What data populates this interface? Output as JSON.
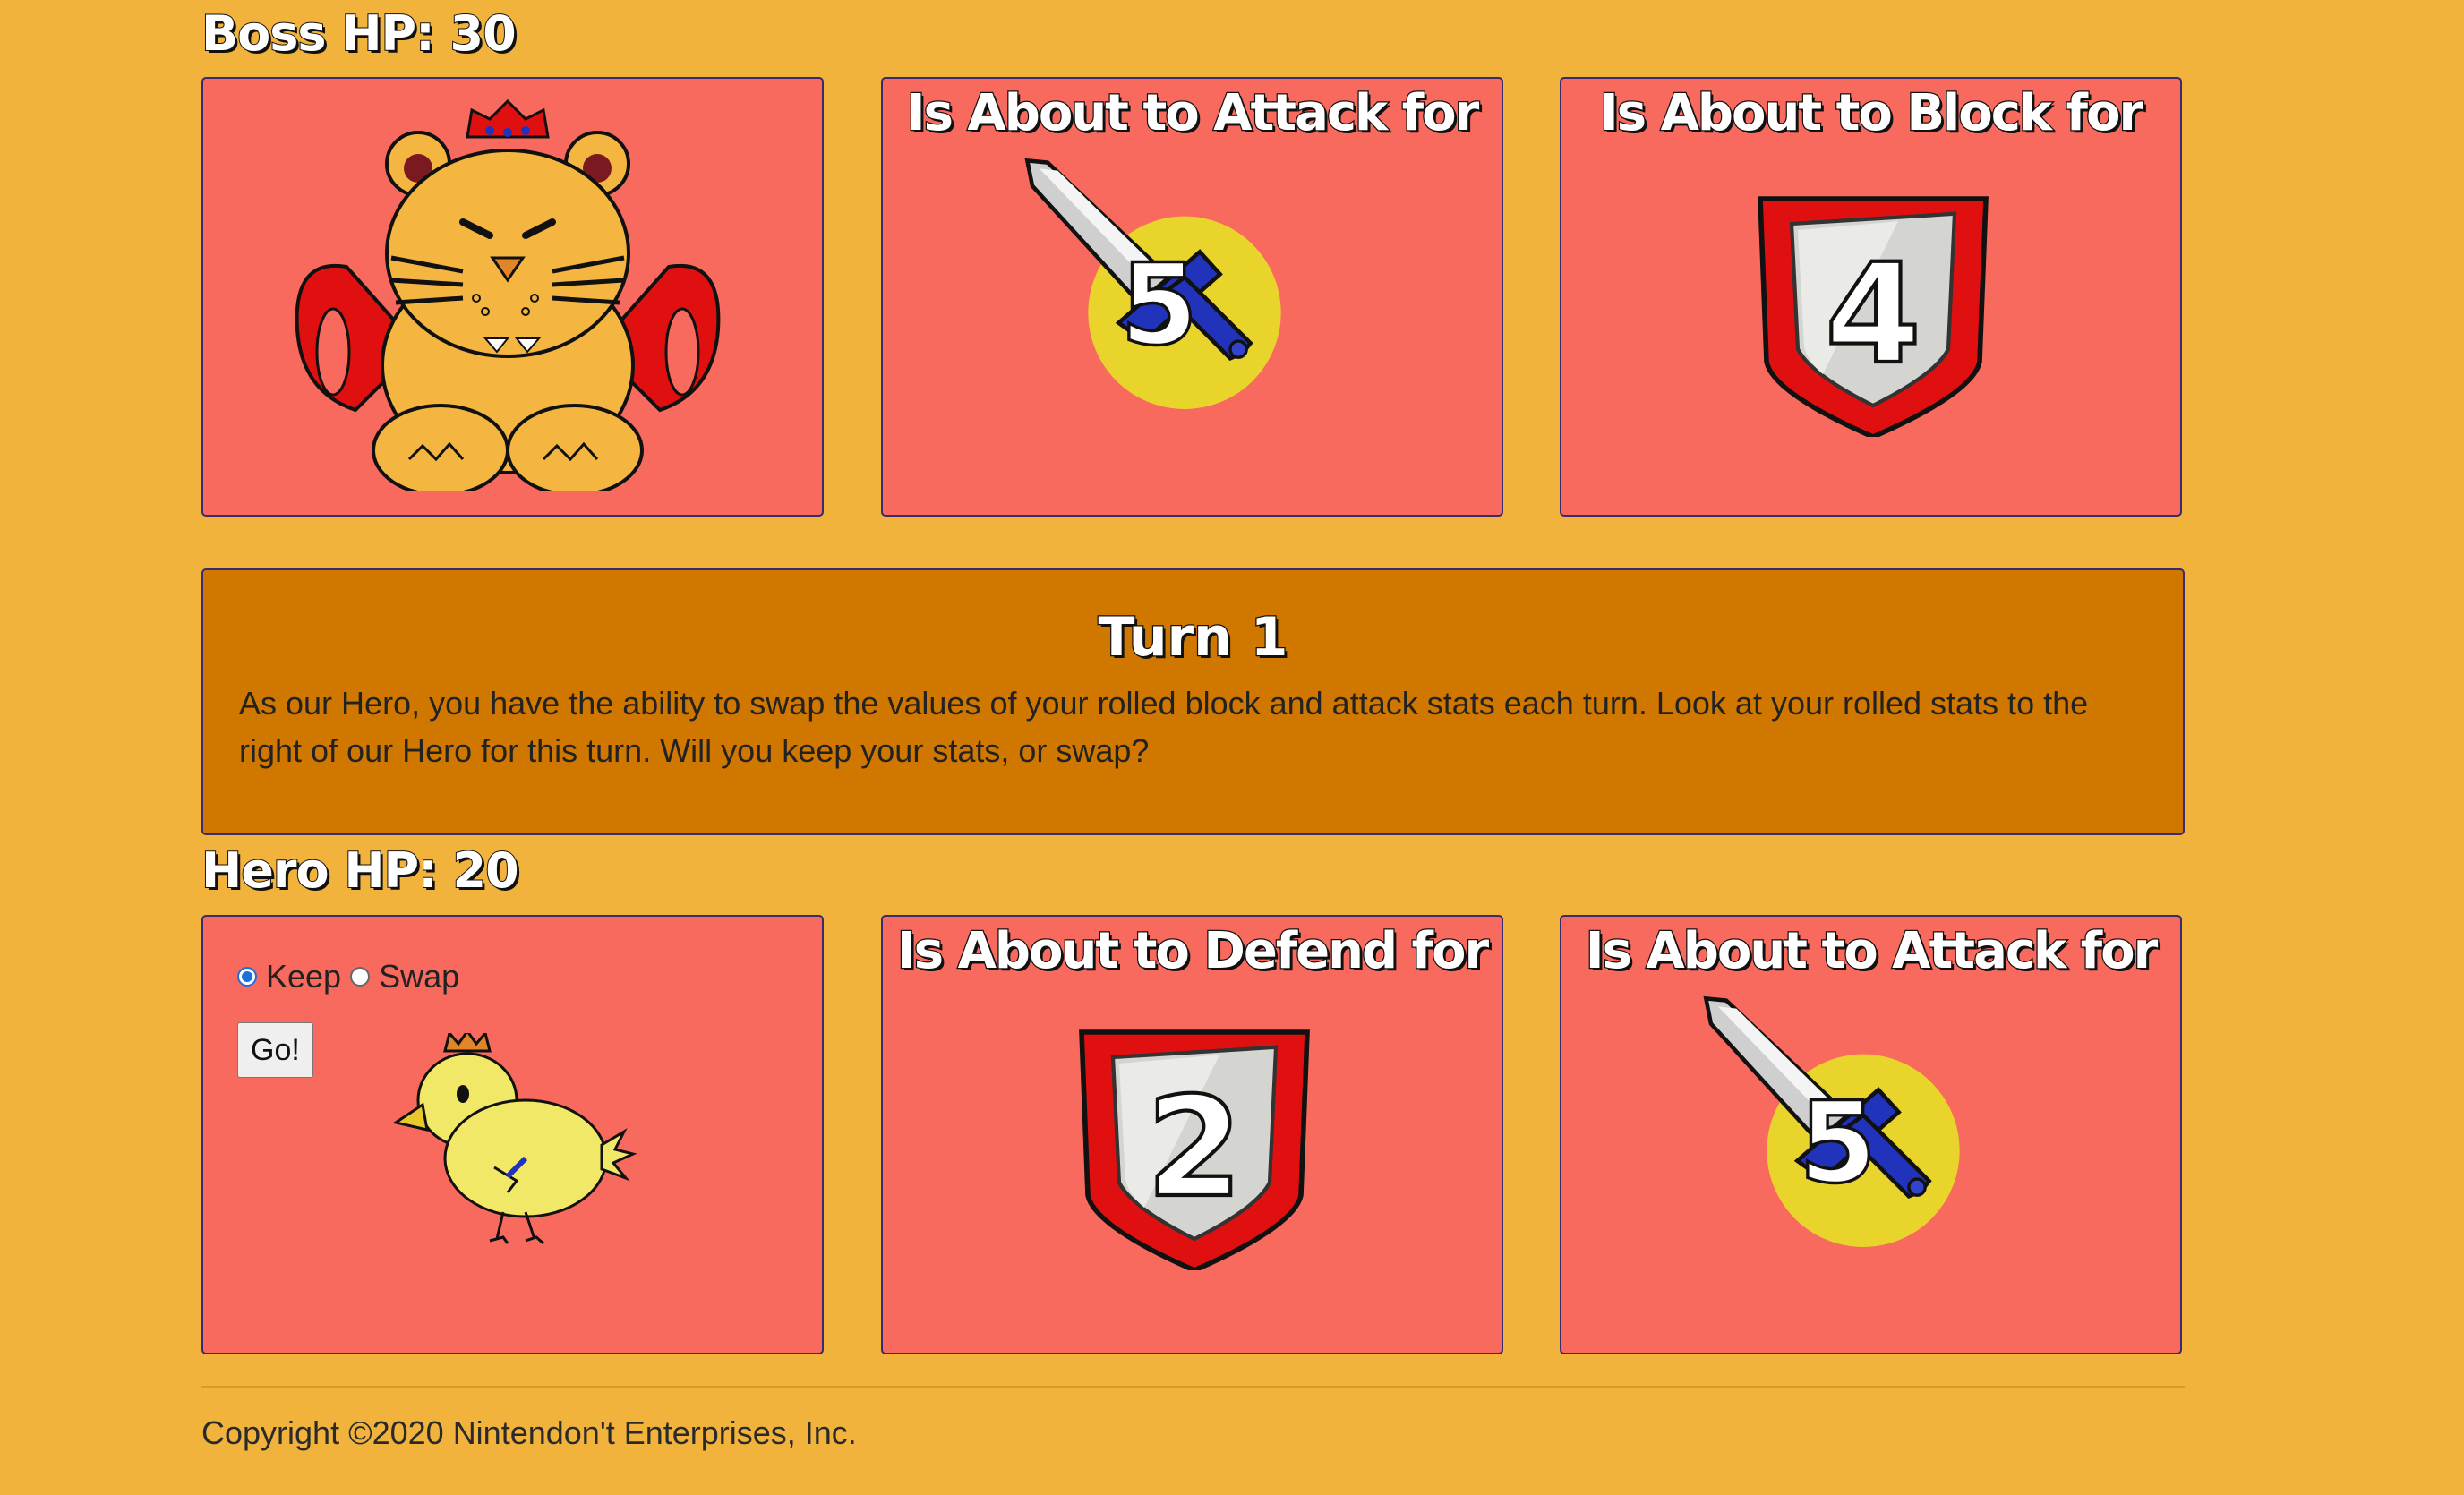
{
  "boss": {
    "hp_label": "Boss HP: 30",
    "attack_title": "Is About to Attack for",
    "attack_value": "5",
    "block_title": "Is About to Block for",
    "block_value": "4"
  },
  "turn": {
    "title": "Turn 1",
    "text": "As our Hero, you have the ability to swap the values of your rolled block and attack stats each turn. Look at your rolled stats to the right of our Hero for this turn. Will you keep your stats, or swap?"
  },
  "hero": {
    "hp_label": "Hero HP: 20",
    "options": {
      "keep": "Keep",
      "swap": "Swap",
      "selected": "Keep"
    },
    "go_label": "Go!",
    "defend_title": "Is About to Defend for",
    "defend_value": "2",
    "attack_title": "Is About to Attack for",
    "attack_value": "5"
  },
  "footer": {
    "copyright": "Copyright ©2020 Nintendon't Enterprises, Inc."
  },
  "icons": {
    "boss": "tiger-king-icon",
    "hero": "chick-hero-icon",
    "attack": "sword-icon",
    "block": "shield-icon"
  },
  "colors": {
    "background": "#F2B33D",
    "card": "#F96A5E",
    "turn_box": "#D07700"
  }
}
